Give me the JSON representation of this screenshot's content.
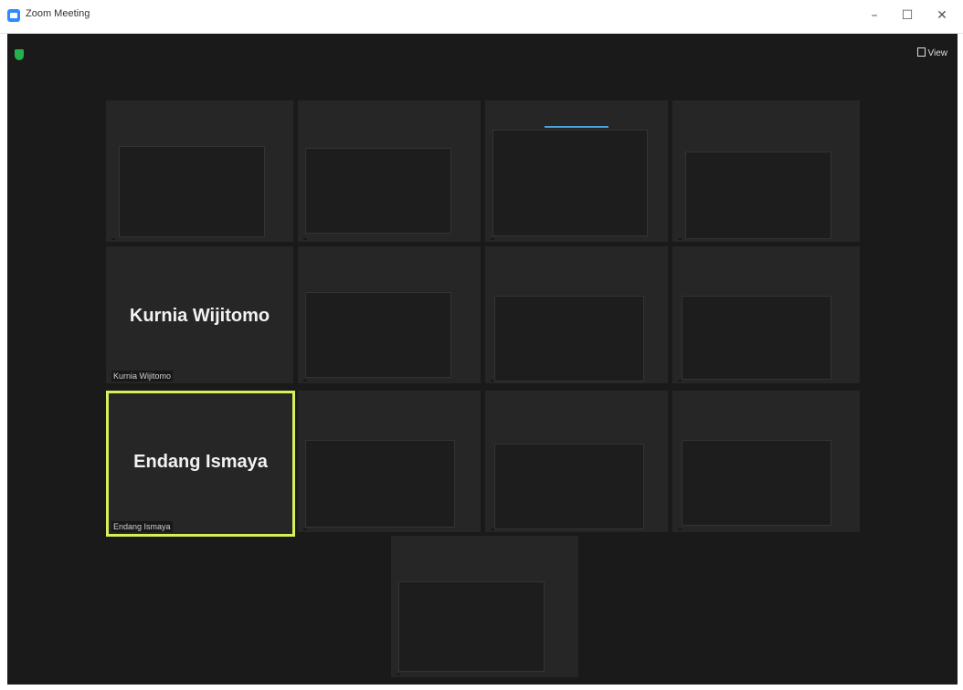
{
  "window": {
    "title": "Zoom Meeting",
    "controls": {
      "minimize": "–",
      "maximize": "☐",
      "close": "✕"
    }
  },
  "toolbar": {
    "view_label": "View"
  },
  "participants": [
    {
      "display_name": "",
      "nameplate": ""
    },
    {
      "display_name": "",
      "nameplate": ""
    },
    {
      "display_name": "",
      "nameplate": ""
    },
    {
      "display_name": "",
      "nameplate": ""
    },
    {
      "display_name": "Kurnia Wijitomo",
      "nameplate": "Kurnia Wijitomo"
    },
    {
      "display_name": "",
      "nameplate": ""
    },
    {
      "display_name": "",
      "nameplate": ""
    },
    {
      "display_name": "",
      "nameplate": ""
    },
    {
      "display_name": "Endang Ismaya",
      "nameplate": "Endang Ismaya",
      "active_speaker": true
    },
    {
      "display_name": "",
      "nameplate": ""
    },
    {
      "display_name": "",
      "nameplate": ""
    },
    {
      "display_name": "",
      "nameplate": ""
    },
    {
      "display_name": "",
      "nameplate": ""
    }
  ],
  "colors": {
    "active_speaker_border": "#d6ef5b",
    "security_shield": "#23b14d",
    "app_icon": "#2d8cff"
  }
}
